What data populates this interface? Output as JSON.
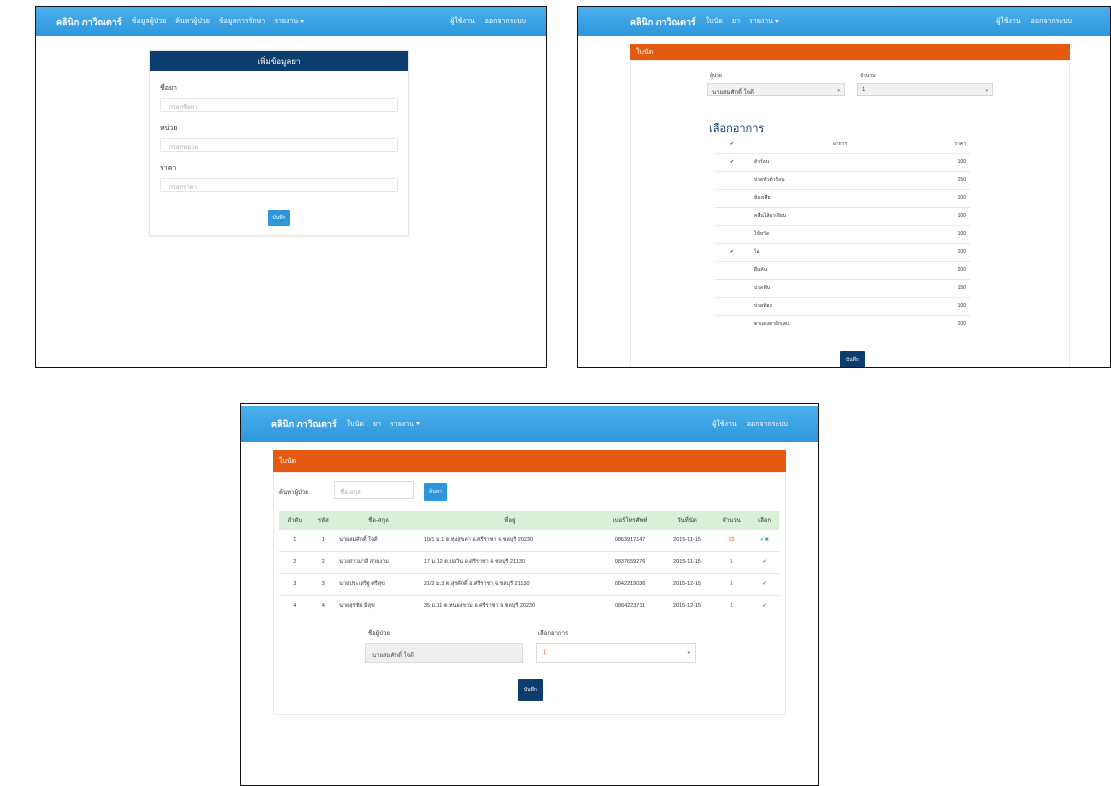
{
  "shot_a": {
    "navbar": {
      "brand": "คลินิก ภาวิณตาร์",
      "items": [
        "ข้อมูลผู้ป่วย",
        "ค้นหาผู้ป่วย",
        "ข้อมูลการรักษา",
        "รายงาน"
      ],
      "right": [
        "ผู้ใช้งาน",
        "ออกจากระบบ"
      ]
    },
    "form": {
      "title": "เพิ่มข้อมูลยา",
      "fields": [
        {
          "label": "ชื่อยา",
          "placeholder": "กรอกชื่อยา"
        },
        {
          "label": "หน่วย",
          "placeholder": "กรอกหน่วย"
        },
        {
          "label": "ราคา",
          "placeholder": "กรอกราคา"
        }
      ],
      "save": "บันทึก"
    }
  },
  "shot_b": {
    "navbar": {
      "brand": "คลินิก ภาวิณตาร์",
      "items": [
        "ใบนัด",
        "ยา",
        "รายงาน"
      ],
      "right": [
        "ผู้ใช้งาน",
        "ออกจากระบบ"
      ]
    },
    "panel_title": "ใบนัด",
    "patient_label": "ผู้ป่วย",
    "patient_value": "นายสมศักดิ์ ใจดี",
    "count_label": "จำนวน",
    "count_value": "1",
    "section_title": "เลือกอาการ",
    "table": {
      "headers": [
        "✔",
        "อาการ",
        "ราคา"
      ],
      "rows": [
        {
          "mark": "✔",
          "name": "ตัวร้อน",
          "price": "100"
        },
        {
          "mark": "",
          "name": "ปวดหัวตัวร้อน",
          "price": "150"
        },
        {
          "mark": "",
          "name": "ท้องเสีย",
          "price": "100"
        },
        {
          "mark": "",
          "name": "คลื่นไส้อาเจียน",
          "price": "100"
        },
        {
          "mark": "",
          "name": "ไข้หวัด",
          "price": "100"
        },
        {
          "mark": "✔",
          "name": "ไอ",
          "price": "100"
        },
        {
          "mark": "",
          "name": "ผื่นคัน",
          "price": "200"
        },
        {
          "mark": "",
          "name": "ปวดฟัน",
          "price": "150"
        },
        {
          "mark": "",
          "name": "ปวดท้อง",
          "price": "100"
        },
        {
          "mark": "",
          "name": "ตาแดงตาอักเสบ",
          "price": "100"
        }
      ]
    },
    "save": "บันทึก"
  },
  "shot_c": {
    "navbar": {
      "brand": "คลินิก ภาวิณตาร์",
      "items": [
        "ใบนัด",
        "ยา",
        "รายงาน"
      ],
      "right": [
        "ผู้ใช้งาน",
        "ออกจากระบบ"
      ]
    },
    "panel_title": "ใบนัด",
    "search_label": "ค้นหาผู้ป่วย",
    "search_placeholder": "ชื่อ-สกุล",
    "search_button": "ค้นหา",
    "table": {
      "headers": [
        "ลำดับ",
        "รหัส",
        "ชื่อ-สกุล",
        "ที่อยู่",
        "เบอร์โทรศัพท์",
        "วันที่นัด",
        "จำนวน",
        "เลือก"
      ],
      "rows": [
        {
          "no": "1",
          "id": "1",
          "name": "นายสมศักดิ์ ใจดี",
          "address": "10/1 ม.1 ต.ทุ่งสุขลา อ.ศรีราชา จ.ชลบุรี 20230",
          "phone": "0863917147",
          "date": "2015-11-15",
          "count": "15",
          "pick": "✔✖"
        },
        {
          "no": "2",
          "id": "2",
          "name": "นางสาวมาลี สวยงาม",
          "address": "17 ม.12 ต.บ่อวิน อ.ศรีราชา จ.ชลบุรี 21130",
          "phone": "0837659276",
          "date": "2015-11-15",
          "count": "1",
          "pick": "✔"
        },
        {
          "no": "3",
          "id": "3",
          "name": "นายประเสริฐ ศรีสุข",
          "address": "21/2 ม.3 ต.สุรศักดิ์ อ.ศรีราชา จ.ชลบุรี 21130",
          "phone": "0842219036",
          "date": "2015-12-15",
          "count": "1",
          "pick": "✔"
        },
        {
          "no": "4",
          "id": "4",
          "name": "นายสุรชัย มีสุข",
          "address": "35 ม.11 ต.หนองขาม อ.ศรีราชา จ.ชลบุรี 20230",
          "phone": "0864223711",
          "date": "2015-12-15",
          "count": "1",
          "pick": "✔"
        }
      ]
    },
    "patient_label": "ชื่อผู้ป่วย",
    "patient_value": "นายสมศักดิ์ ใจดี",
    "count_label": "เลือกอาการ",
    "count_value": "1",
    "save": "บันทึก"
  }
}
